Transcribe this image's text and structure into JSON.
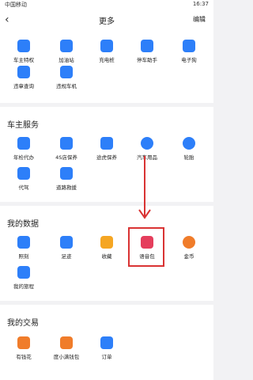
{
  "statusbar": {
    "carrier": "中国移动",
    "time": "16:37"
  },
  "header": {
    "title": "更多",
    "edit_label": "编辑",
    "back_glyph": "‹"
  },
  "top_section": {
    "items": [
      {
        "label": "车主特权",
        "color": "#2d7ff9"
      },
      {
        "label": "加油站",
        "color": "#2d7ff9"
      },
      {
        "label": "充电桩",
        "color": "#2d7ff9"
      },
      {
        "label": "停车助手",
        "color": "#2d7ff9"
      },
      {
        "label": "电子狗",
        "color": "#2d7ff9"
      },
      {
        "label": "违章查询",
        "color": "#2d7ff9"
      },
      {
        "label": "违规车机",
        "color": "#2d7ff9"
      }
    ]
  },
  "car_services": {
    "title": "车主服务",
    "items": [
      {
        "label": "年检代办",
        "color": "#2d7ff9"
      },
      {
        "label": "4S店保养",
        "color": "#2d7ff9"
      },
      {
        "label": "途虎保养",
        "color": "#2d7ff9"
      },
      {
        "label": "汽车用品",
        "color": "#2d7ff9"
      },
      {
        "label": "轮胎",
        "color": "#2d7ff9"
      },
      {
        "label": "代驾",
        "color": "#2d7ff9"
      },
      {
        "label": "道路救援",
        "color": "#2d7ff9"
      }
    ]
  },
  "my_data": {
    "title": "我的数据",
    "items": [
      {
        "label": "照刻",
        "color": "#2d7ff9"
      },
      {
        "label": "足迹",
        "color": "#2d7ff9"
      },
      {
        "label": "收藏",
        "color": "#f5a623"
      },
      {
        "label": "语音包",
        "color": "#e53e5c"
      },
      {
        "label": "金币",
        "color": "#f07c2a"
      },
      {
        "label": "我的旅程",
        "color": "#2d7ff9"
      }
    ]
  },
  "my_trades": {
    "title": "我的交易",
    "items": [
      {
        "label": "有钱花",
        "color": "#f07c2a"
      },
      {
        "label": "度小满钱包",
        "color": "#f07c2a"
      },
      {
        "label": "订单",
        "color": "#2d7ff9"
      }
    ]
  },
  "accent_color": "#d93333"
}
